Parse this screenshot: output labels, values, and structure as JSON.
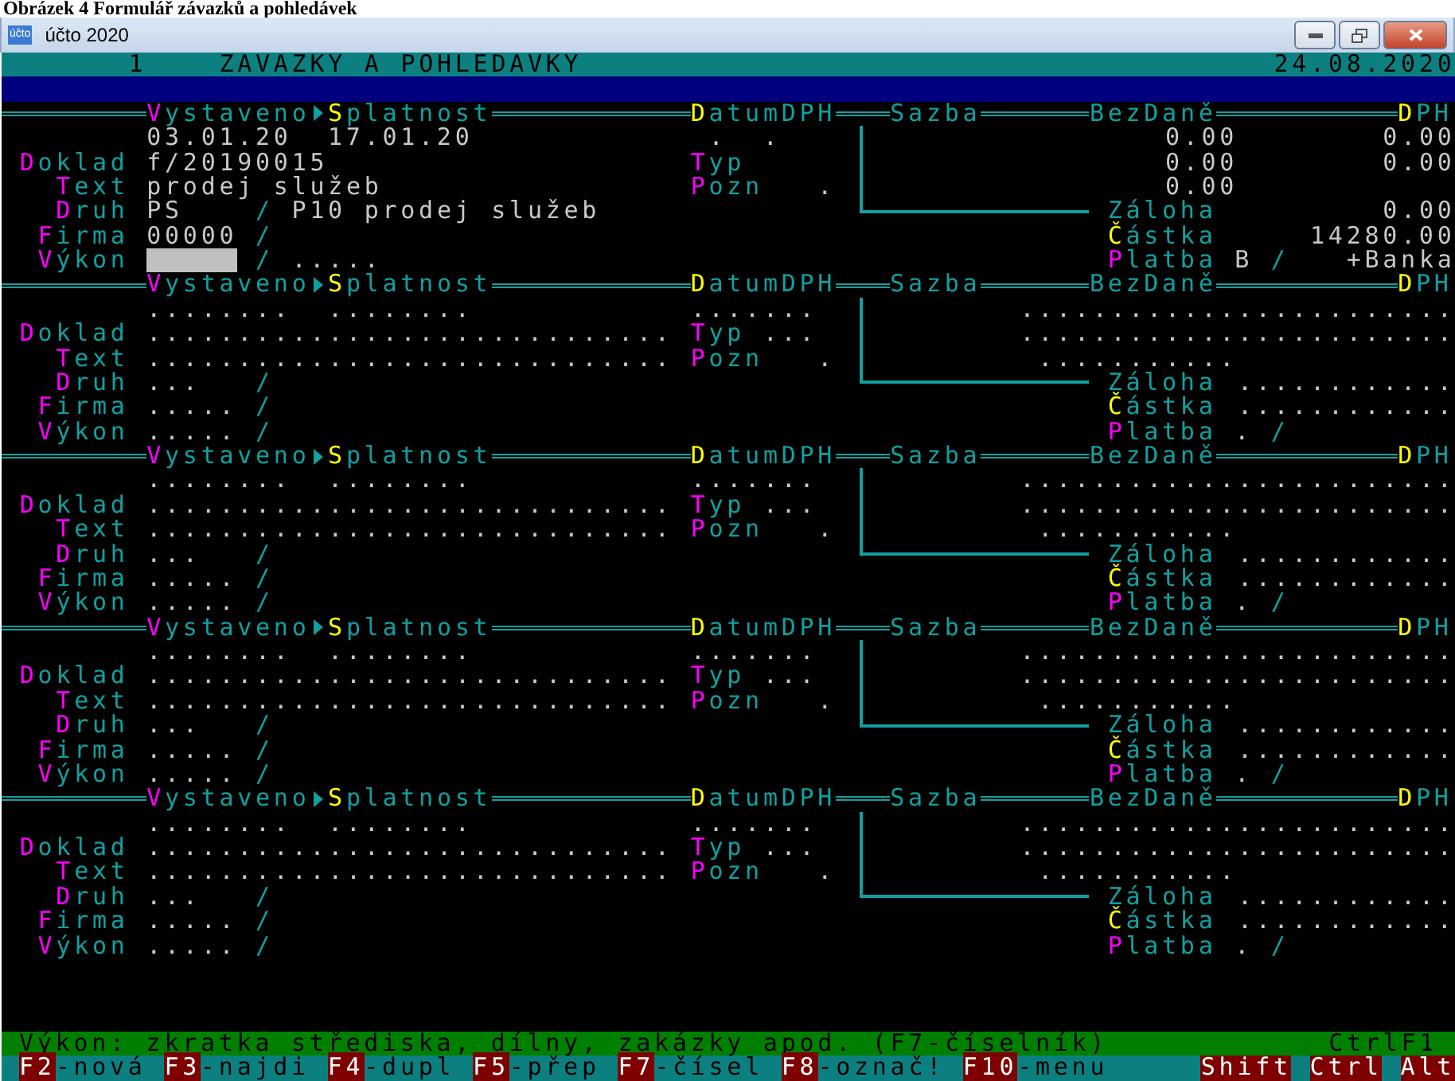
{
  "caption": "Obrázek 4 Formulář závazků a pohledávek",
  "window": {
    "title": "účto 2020",
    "icon_text": "účto"
  },
  "screen_header": {
    "number": "1",
    "title": "ZAVAZKY A POHLEDAVKY",
    "date": "24.08.2020"
  },
  "records": [
    {
      "header": [
        {
          "text": "Vystaveno",
          "color": "#ff00ff"
        },
        {
          "text": "Splatnost",
          "color": "#ffff00"
        },
        {
          "text": "DatumDPH",
          "color": "#ffff00"
        },
        {
          "text": "Sazba"
        },
        {
          "text": "BezDaně"
        },
        {
          "text": "DPH",
          "color": "#ffff00"
        }
      ],
      "left_labels": [
        {
          "text": "Doklad",
          "color": "#ff00ff"
        },
        {
          "text": "Text",
          "color": "#ff00ff"
        },
        {
          "text": "Druh",
          "color": "#ff00ff"
        },
        {
          "text": "Firma",
          "color": "#ff00ff"
        },
        {
          "text": "Výkon",
          "color": "#ff00ff"
        }
      ],
      "mid_labels": [
        {
          "text": "Typ",
          "color": "#ff00ff"
        },
        {
          "text": "Pozn",
          "color": "#ff00ff"
        }
      ],
      "right_labels": [
        {
          "text": "Záloha"
        },
        {
          "text": "Částka",
          "color": "#ffff00"
        },
        {
          "text": "Platba",
          "color": "#ff00ff"
        }
      ],
      "issued": "03.01.20",
      "due": "17.01.20",
      "vat_date": ".  .",
      "document": "f/20190015",
      "text": "prodej služeb",
      "note": ".",
      "kind_code": "PS",
      "kind_sep": "/",
      "kind_name": "P10 prodej služeb",
      "company": "00000",
      "company_sep": "/",
      "performance": {
        "active": true
      },
      "performance_sep": "/",
      "performance_detail": ".....",
      "base_values": [
        "0.00",
        "0.00",
        "0.00"
      ],
      "vat_values": [
        "0.00",
        "0.00"
      ],
      "advance": "0.00",
      "amount": "14280.00",
      "payment_code": "B",
      "payment_sep": "/",
      "payment_name": "+Banka"
    },
    {
      "header": [
        {
          "text": "Vystaveno",
          "color": "#ff00ff"
        },
        {
          "text": "Splatnost",
          "color": "#ffff00"
        },
        {
          "text": "DatumDPH",
          "color": "#ffff00"
        },
        {
          "text": "Sazba"
        },
        {
          "text": "BezDaně"
        },
        {
          "text": "DPH",
          "color": "#ffff00"
        }
      ],
      "left_labels": [
        {
          "text": "Doklad",
          "color": "#ff00ff"
        },
        {
          "text": "Text",
          "color": "#ff00ff"
        },
        {
          "text": "Druh",
          "color": "#ff00ff"
        },
        {
          "text": "Firma",
          "color": "#ff00ff"
        },
        {
          "text": "Výkon",
          "color": "#ff00ff"
        }
      ],
      "mid_labels": [
        {
          "text": "Typ",
          "color": "#ff00ff"
        },
        {
          "text": "Pozn",
          "color": "#ff00ff"
        }
      ],
      "right_labels": [
        {
          "text": "Záloha"
        },
        {
          "text": "Částka",
          "color": "#ffff00"
        },
        {
          "text": "Platba",
          "color": "#ff00ff"
        }
      ],
      "issued": "........",
      "due": "........",
      "vat_date": ".......",
      "document": ".............................",
      "text": ".............................",
      "type": "...",
      "note": ".",
      "kind_code": "...",
      "kind_sep": "/",
      "company": ".....",
      "company_sep": "/",
      "performance": {
        "value": ".....",
        "active": false
      },
      "performance_sep": "/",
      "base_values": [
        "............",
        "............",
        "..........."
      ],
      "vat_values": [
        "............",
        "............"
      ],
      "advance": "............",
      "amount": "............",
      "payment_code": ".",
      "payment_sep": "/"
    },
    {
      "header": [
        {
          "text": "Vystaveno",
          "color": "#ff00ff"
        },
        {
          "text": "Splatnost",
          "color": "#ffff00"
        },
        {
          "text": "DatumDPH",
          "color": "#ffff00"
        },
        {
          "text": "Sazba"
        },
        {
          "text": "BezDaně"
        },
        {
          "text": "DPH",
          "color": "#ffff00"
        }
      ],
      "left_labels": [
        {
          "text": "Doklad",
          "color": "#ff00ff"
        },
        {
          "text": "Text",
          "color": "#ff00ff"
        },
        {
          "text": "Druh",
          "color": "#ff00ff"
        },
        {
          "text": "Firma",
          "color": "#ff00ff"
        },
        {
          "text": "Výkon",
          "color": "#ff00ff"
        }
      ],
      "mid_labels": [
        {
          "text": "Typ",
          "color": "#ff00ff"
        },
        {
          "text": "Pozn",
          "color": "#ff00ff"
        }
      ],
      "right_labels": [
        {
          "text": "Záloha"
        },
        {
          "text": "Částka",
          "color": "#ffff00"
        },
        {
          "text": "Platba",
          "color": "#ff00ff"
        }
      ],
      "issued": "........",
      "due": "........",
      "vat_date": ".......",
      "document": ".............................",
      "text": ".............................",
      "type": "...",
      "note": ".",
      "kind_code": "...",
      "kind_sep": "/",
      "company": ".....",
      "company_sep": "/",
      "performance": {
        "value": ".....",
        "active": false
      },
      "performance_sep": "/",
      "base_values": [
        "............",
        "............",
        "..........."
      ],
      "vat_values": [
        "............",
        "............"
      ],
      "advance": "............",
      "amount": "............",
      "payment_code": ".",
      "payment_sep": "/"
    },
    {
      "header": [
        {
          "text": "Vystaveno",
          "color": "#ff00ff"
        },
        {
          "text": "Splatnost",
          "color": "#ffff00"
        },
        {
          "text": "DatumDPH",
          "color": "#ffff00"
        },
        {
          "text": "Sazba"
        },
        {
          "text": "BezDaně"
        },
        {
          "text": "DPH",
          "color": "#ffff00"
        }
      ],
      "left_labels": [
        {
          "text": "Doklad",
          "color": "#ff00ff"
        },
        {
          "text": "Text",
          "color": "#ff00ff"
        },
        {
          "text": "Druh",
          "color": "#ff00ff"
        },
        {
          "text": "Firma",
          "color": "#ff00ff"
        },
        {
          "text": "Výkon",
          "color": "#ff00ff"
        }
      ],
      "mid_labels": [
        {
          "text": "Typ",
          "color": "#ff00ff"
        },
        {
          "text": "Pozn",
          "color": "#ff00ff"
        }
      ],
      "right_labels": [
        {
          "text": "Záloha"
        },
        {
          "text": "Částka",
          "color": "#ffff00"
        },
        {
          "text": "Platba",
          "color": "#ff00ff"
        }
      ],
      "issued": "........",
      "due": "........",
      "vat_date": ".......",
      "document": ".............................",
      "text": ".............................",
      "type": "...",
      "note": ".",
      "kind_code": "...",
      "kind_sep": "/",
      "company": ".....",
      "company_sep": "/",
      "performance": {
        "value": ".....",
        "active": false
      },
      "performance_sep": "/",
      "base_values": [
        "............",
        "............",
        "..........."
      ],
      "vat_values": [
        "............",
        "............"
      ],
      "advance": "............",
      "amount": "............",
      "payment_code": ".",
      "payment_sep": "/"
    },
    {
      "header": [
        {
          "text": "Vystaveno",
          "color": "#ff00ff"
        },
        {
          "text": "Splatnost",
          "color": "#ffff00"
        },
        {
          "text": "DatumDPH",
          "color": "#ffff00"
        },
        {
          "text": "Sazba"
        },
        {
          "text": "BezDaně"
        },
        {
          "text": "DPH",
          "color": "#ffff00"
        }
      ],
      "left_labels": [
        {
          "text": "Doklad",
          "color": "#ff00ff"
        },
        {
          "text": "Text",
          "color": "#ff00ff"
        },
        {
          "text": "Druh",
          "color": "#ff00ff"
        },
        {
          "text": "Firma",
          "color": "#ff00ff"
        },
        {
          "text": "Výkon",
          "color": "#ff00ff"
        }
      ],
      "mid_labels": [
        {
          "text": "Typ",
          "color": "#ff00ff"
        },
        {
          "text": "Pozn",
          "color": "#ff00ff"
        }
      ],
      "right_labels": [
        {
          "text": "Záloha"
        },
        {
          "text": "Částka",
          "color": "#ffff00"
        },
        {
          "text": "Platba",
          "color": "#ff00ff"
        }
      ],
      "issued": "........",
      "due": "........",
      "vat_date": ".......",
      "document": ".............................",
      "text": ".............................",
      "type": "...",
      "note": ".",
      "kind_code": "...",
      "kind_sep": "/",
      "company": ".....",
      "company_sep": "/",
      "performance": {
        "value": ".....",
        "active": false
      },
      "performance_sep": "/",
      "base_values": [
        "............",
        "............",
        "..........."
      ],
      "vat_values": [
        "............",
        "............"
      ],
      "advance": "............",
      "amount": "............",
      "payment_code": ".",
      "payment_sep": "/"
    }
  ],
  "status_bar": {
    "hint": "Výkon: zkratka střediska, dílny, zakázky apod. (F7-číselník)",
    "shortcut": "CtrlF1"
  },
  "function_keys": [
    {
      "key": "F2",
      "label": "-nová"
    },
    {
      "key": "F3",
      "label": "-najdi"
    },
    {
      "key": "F4",
      "label": "-dupl"
    },
    {
      "key": "F5",
      "label": "-přep"
    },
    {
      "key": "F7",
      "label": "-čísel"
    },
    {
      "key": "F8",
      "label": "-označ!"
    },
    {
      "key": "F10",
      "label": "-menu"
    }
  ],
  "modifier_keys": [
    "Shift",
    "Ctrl",
    "Alt"
  ]
}
